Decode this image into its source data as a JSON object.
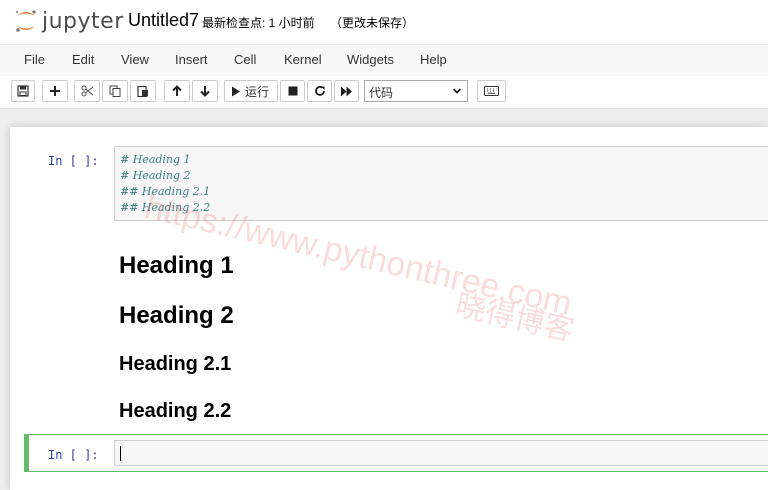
{
  "header": {
    "logo_text": "jupyter",
    "notebook_title": "Untitled7",
    "checkpoint": "最新检查点: 1 小时前",
    "autosave_status": "（更改未保存）"
  },
  "menubar": {
    "items": [
      "File",
      "Edit",
      "View",
      "Insert",
      "Cell",
      "Kernel",
      "Widgets",
      "Help"
    ]
  },
  "toolbar": {
    "run_label": "运行",
    "cell_type": "代码"
  },
  "cells": [
    {
      "prompt": "In [ ]:",
      "code_lines": [
        "# Heading 1",
        "# Heading 2",
        "## Heading 2.1",
        "## Heading 2.2"
      ]
    },
    {
      "prompt": "In [ ]:",
      "code_lines": []
    }
  ],
  "rendered_markdown": {
    "headings": [
      "Heading 1",
      "Heading 2",
      "Heading 2.1",
      "Heading 2.2"
    ]
  },
  "watermark": {
    "url": "https://www.pythonthree.com",
    "brand": "晓得博客"
  },
  "colors": {
    "prompt": "#303f9f",
    "comment": "#408080",
    "selected_cell": "#66bb6a",
    "logo_orange": "#f37726"
  }
}
